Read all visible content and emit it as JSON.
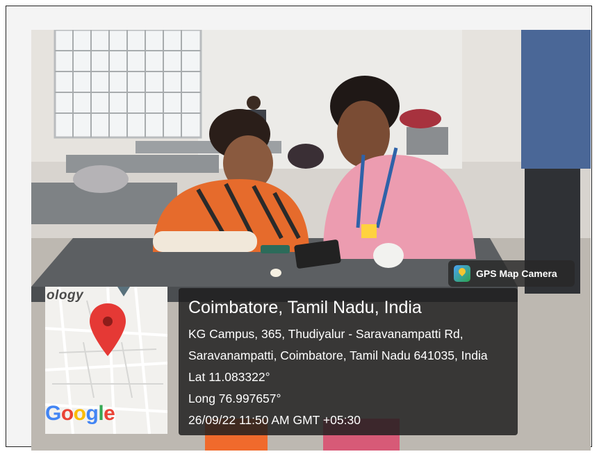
{
  "overlay": {
    "badge_label": "GPS Map Camera",
    "map_brand_text": "ology",
    "map_logo": [
      "G",
      "o",
      "o",
      "g",
      "l",
      "e"
    ],
    "location_title": "Coimbatore, Tamil Nadu, India",
    "address_line_1": "KG Campus, 365, Thudiyalur - Saravanampatti Rd,",
    "address_line_2": "Saravanampatti, Coimbatore, Tamil Nadu 641035, India",
    "latitude": "Lat 11.083322°",
    "longitude": "Long 76.997657°",
    "timestamp": "26/09/22 11:50 AM GMT +05:30",
    "pin_color": "#e53935"
  }
}
